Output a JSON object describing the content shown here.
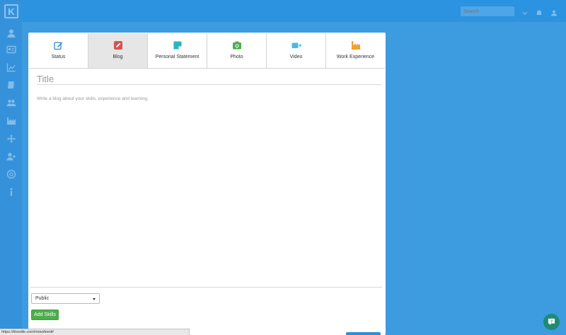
{
  "app": {
    "logo_text": "K"
  },
  "sidebar": {
    "items": [
      {
        "icon": "user-icon"
      },
      {
        "icon": "id-card-icon"
      },
      {
        "icon": "line-chart-icon"
      },
      {
        "icon": "book-icon"
      },
      {
        "icon": "users-icon"
      },
      {
        "icon": "industry-icon"
      },
      {
        "icon": "move-icon"
      },
      {
        "icon": "user-plus-icon"
      },
      {
        "icon": "help-circle-icon"
      },
      {
        "icon": "info-icon"
      }
    ]
  },
  "topbar": {
    "search_placeholder": "Search",
    "icons": [
      "chevron-down-icon",
      "bell-icon",
      "avatar-icon"
    ]
  },
  "post_types": [
    {
      "label": "Status",
      "icon": "edit-icon",
      "color": "#2f86c9",
      "active": false
    },
    {
      "label": "Blog",
      "icon": "pencil-icon",
      "color": "#d9534f",
      "active": true
    },
    {
      "label": "Personal Statement",
      "icon": "sticky-note-icon",
      "color": "#2bb3c0",
      "active": false
    },
    {
      "label": "Photo",
      "icon": "camera-icon",
      "color": "#4cae4c",
      "active": false
    },
    {
      "label": "Video",
      "icon": "video-camera-icon",
      "color": "#4cb9e0",
      "active": false
    },
    {
      "label": "Work Experience",
      "icon": "industry-icon",
      "color": "#f0a030",
      "active": false
    }
  ],
  "editor": {
    "title_placeholder": "Title",
    "body_placeholder": "Write a blog about your skills, experience and learning."
  },
  "privacy": {
    "selected": "Public"
  },
  "buttons": {
    "add_skills": "Add Skills"
  },
  "status_bar": {
    "url": "https://kloodle.com/newsfeed#"
  },
  "colors": {
    "background": "#3d9be0",
    "topbar": "#2b93e0",
    "sidebar": "#3592da",
    "success": "#4cae4c",
    "help_fab": "#1f8a77"
  }
}
